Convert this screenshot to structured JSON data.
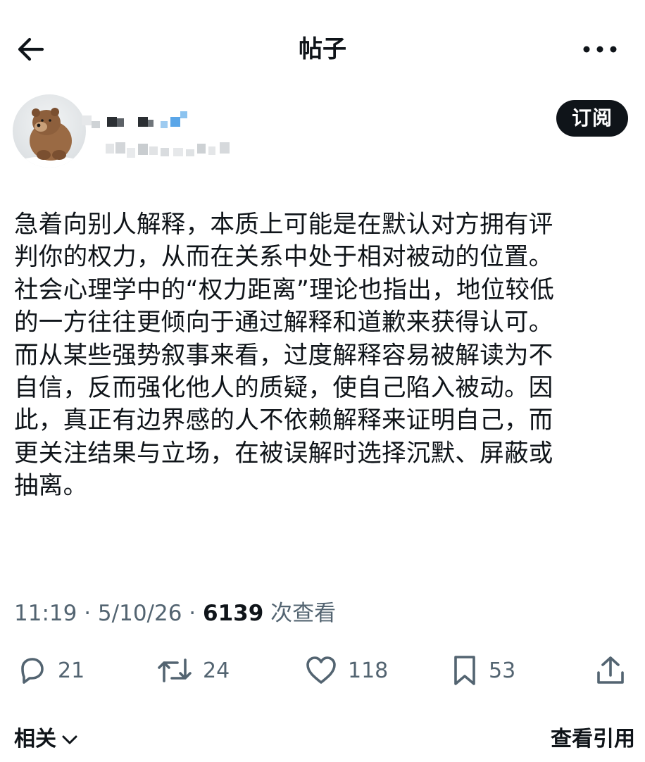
{
  "header": {
    "title": "帖子",
    "back_icon": "arrow-left-icon",
    "more_icon": "more-dots-icon"
  },
  "author": {
    "subscribe_label": "订阅"
  },
  "post": {
    "text": "急着向别人解释，本质上可能是在默认对方拥有评\n判你的权力，从而在关系中处于相对被动的位置。\n社会心理学中的“权力距离”理论也指出，地位较低\n的一方往往更倾向于通过解释和道歉来获得认可。\n而从某些强势叙事来看，过度解释容易被解读为不\n自信，反而强化他人的质疑，使自己陷入被动。因\n此，真正有边界感的人不依赖解释来证明自己，而\n更关注结果与立场，在被误解时选择沉默、屏蔽或\n抽离。",
    "time": "11:19",
    "date": "5/10/26",
    "views": "6139",
    "views_label": "次查看"
  },
  "actions": {
    "reply_count": "21",
    "repost_count": "24",
    "like_count": "118",
    "bookmark_count": "53"
  },
  "footer": {
    "related_label": "相关",
    "view_all_label": "查看引用"
  },
  "colors": {
    "text": "#0f1419",
    "secondary": "#536471",
    "button_bg": "#0f1419",
    "background": "#ffffff"
  }
}
